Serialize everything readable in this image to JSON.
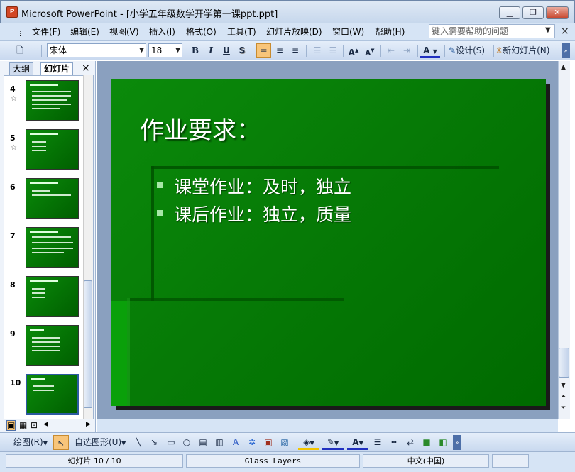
{
  "window": {
    "title": "Microsoft PowerPoint - [小学五年级数学开学第一课ppt.ppt]",
    "app_icon": "P",
    "controls": [
      "minimize-icon",
      "restore-icon",
      "close-icon"
    ]
  },
  "menu": {
    "items": [
      {
        "label": "文件(F)"
      },
      {
        "label": "编辑(E)"
      },
      {
        "label": "视图(V)"
      },
      {
        "label": "插入(I)"
      },
      {
        "label": "格式(O)"
      },
      {
        "label": "工具(T)"
      },
      {
        "label": "幻灯片放映(D)"
      },
      {
        "label": "窗口(W)"
      },
      {
        "label": "帮助(H)"
      }
    ],
    "help_placeholder": "键入需要帮助的问题"
  },
  "toolbar": {
    "font_name": "宋体",
    "font_size": "18",
    "bold": "B",
    "italic": "I",
    "underline": "U",
    "shadow": "S",
    "design_label": "设计(S)",
    "new_slide_label": "新幻灯片(N)",
    "font_color_glyph": "A",
    "increase_font": "A",
    "decrease_font": "A"
  },
  "left_pane": {
    "tabs": [
      {
        "label": "大纲"
      },
      {
        "label": "幻灯片"
      }
    ],
    "close_glyph": "×",
    "thumbnails": [
      {
        "number": "4",
        "star": "☆"
      },
      {
        "number": "5",
        "star": "☆"
      },
      {
        "number": "6",
        "star": ""
      },
      {
        "number": "7",
        "star": ""
      },
      {
        "number": "8",
        "star": ""
      },
      {
        "number": "9",
        "star": ""
      },
      {
        "number": "10",
        "star": ""
      }
    ],
    "selected": "10"
  },
  "slide": {
    "title": "作业要求：",
    "bullets": [
      "课堂作业：及时，独立",
      "课后作业：独立，质量"
    ]
  },
  "drawing_toolbar": {
    "draw_label": "绘图(R)",
    "autoshapes_label": "自选图形(U)"
  },
  "status": {
    "slide_info": "幻灯片 10 / 10",
    "design_name": "Glass Layers",
    "language": "中文(中国)"
  },
  "colors": {
    "slide_green": "#067a06",
    "accent_orange": "#f8c57a",
    "chrome_blue": "#d6e4f5"
  }
}
